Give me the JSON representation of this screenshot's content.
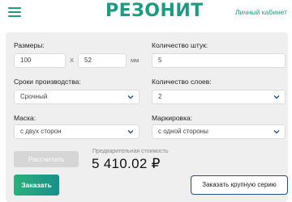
{
  "header": {
    "logo": "РЕЗОНИТ",
    "cabinet": "Личный кабинет"
  },
  "form": {
    "sizes_label": "Размеры:",
    "width_value": "100",
    "times_sign": "X",
    "height_value": "52",
    "unit": "мм",
    "quantity_label": "Количество штук:",
    "quantity_value": "5",
    "terms_label": "Сроки производства:",
    "terms_value": "Срочный",
    "layers_label": "Количество слоев:",
    "layers_value": "2",
    "mask_label": "Маска:",
    "mask_value": "с двух сторон",
    "marking_label": "Маркировка:",
    "marking_value": "с одной стороны"
  },
  "actions": {
    "calculate": "Рассчитать",
    "price_caption": "Предварительная стоимость",
    "price": "5 410.02 ₽",
    "order": "Заказать",
    "order_series": "Заказать крупную серию"
  },
  "colors": {
    "brand": "#1c9a82",
    "chevron": "#1f4f8c",
    "outline_button": "#1f4f8c"
  },
  "icons": {
    "menu": "hamburger-menu-icon",
    "select": "chevron-down-icon"
  }
}
